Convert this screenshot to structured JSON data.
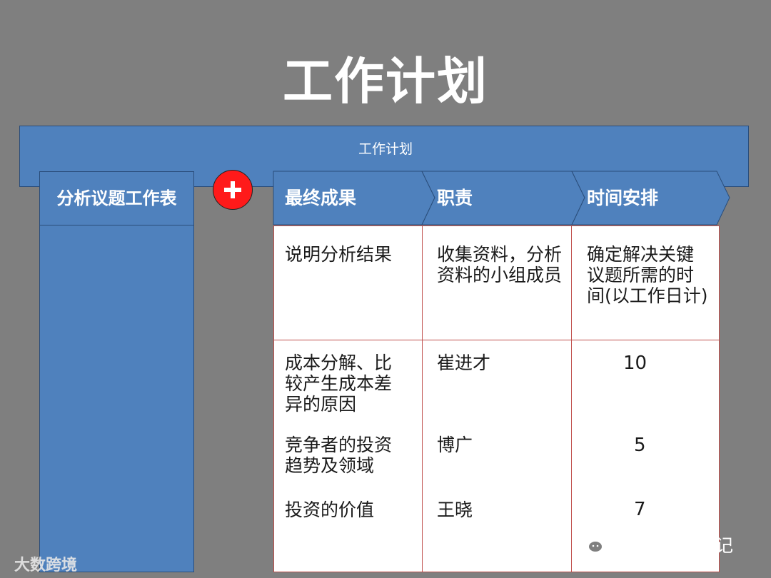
{
  "title": "工作计划",
  "banner": "工作计划",
  "left_header": "分析议题工作表",
  "headers": [
    "最终成果",
    "职责",
    "时间安排"
  ],
  "rows": [
    {
      "result": "说明分析结果",
      "owner": "收集资料，分析资料的小组成员",
      "time": "确定解决关键议题所需的时间(以工作日计)"
    },
    {
      "result": "成本分解、比较产生成本差异的原因",
      "owner": "崔进才",
      "time": "10"
    },
    {
      "result": "竞争者的投资趋势及领域",
      "owner": "博广",
      "time": "5"
    },
    {
      "result": "投资的价值",
      "owner": "王晓",
      "time": "7"
    }
  ],
  "watermark_left": "大数跨境",
  "watermark_right": "领导者管理笔记",
  "colors": {
    "background": "#7f7f7f",
    "blue": "#4f81bd",
    "plus_red": "#ff1a1a",
    "grid_red": "#c0504d"
  }
}
